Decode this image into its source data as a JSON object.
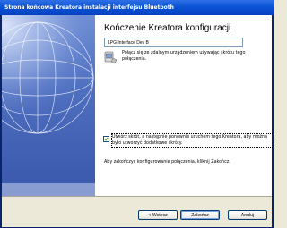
{
  "window": {
    "title": "Strona końcowa Kreatora instalacji interfejsu Bluetooth"
  },
  "colors": {
    "titlebar": "#0a53d6",
    "banner": "#4f6fc0",
    "button_border": "#003c74"
  },
  "wizard": {
    "heading": "Kończenie Kreatora konfiguracji",
    "connection_name": "LPG Interface Dev B",
    "device_icon": "bluetooth-device-icon",
    "device_text": "Połącz się ze zdalnym urządzeniem używając skrótu tego połączenia.",
    "shortcut_checkbox": {
      "checked": true,
      "label": "Utwórz skrót, a następnie ponownie uruchom tego Kreatora, aby można było utworzyć dodatkowe skróty."
    },
    "finish_text": "Aby zakończyć konfigurowanie połączenia, kliknij Zakończ."
  },
  "buttons": {
    "back": "< Wstecz",
    "finish": "Zakończ",
    "cancel": "Anuluj"
  }
}
